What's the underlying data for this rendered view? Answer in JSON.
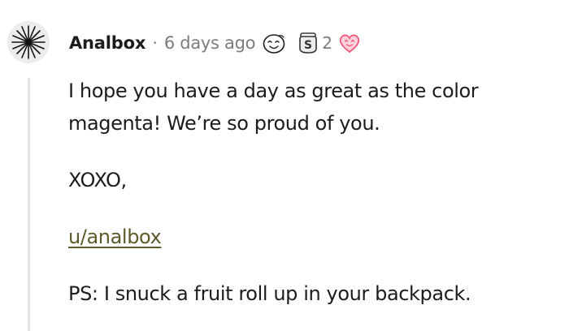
{
  "comment": {
    "author": "Analbox",
    "separator": "·",
    "timestamp": "6 days ago",
    "awards": [
      {
        "icon": "wholesome-face-award-icon"
      },
      {
        "icon": "silver-s-award-icon",
        "count": "2"
      },
      {
        "icon": "heart-eyes-award-icon"
      }
    ],
    "body": {
      "paragraph1": "I hope you have a day as great as the color magenta! We’re so proud of you.",
      "paragraph2": "XOXO,",
      "link": "u/analbox",
      "paragraph4": "PS: I snuck a fruit roll up in your backpack."
    }
  },
  "colors": {
    "author": "#1c1c1c",
    "meta": "#7c7c7c",
    "link": "#5d5a2c",
    "thread_line": "#e6e6e6",
    "heart_award": "#f0587a"
  }
}
